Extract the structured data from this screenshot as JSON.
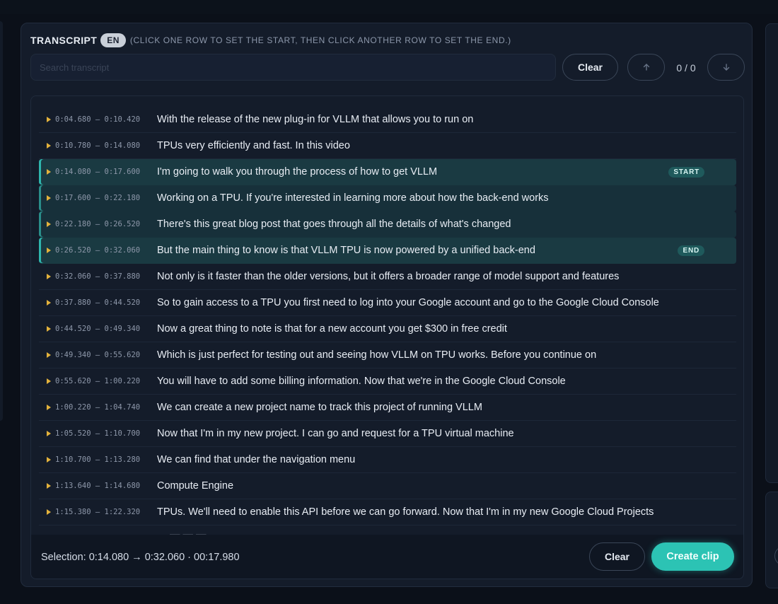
{
  "transcript": {
    "title": "TRANSCRIPT",
    "language": "EN",
    "hint": "(CLICK ONE ROW TO SET THE START, THEN CLICK ANOTHER ROW TO SET THE END.)",
    "search_placeholder": "Search transcript",
    "clear_label": "Clear",
    "match_counter": "0 / 0"
  },
  "rows": [
    {
      "time": "0:04.680 – 0:10.420",
      "text": "With the release of the new plug-in for VLLM that allows you to run on",
      "state": "none",
      "badge": ""
    },
    {
      "time": "0:10.780 – 0:14.080",
      "text": "TPUs very efficiently and fast. In this video",
      "state": "none",
      "badge": ""
    },
    {
      "time": "0:14.080 – 0:17.600",
      "text": "I'm going to walk you through the process of how to get VLLM",
      "state": "start",
      "badge": "START"
    },
    {
      "time": "0:17.600 – 0:22.180",
      "text": "Working on a TPU. If you're interested in learning more about how the back-end works",
      "state": "mid",
      "badge": ""
    },
    {
      "time": "0:22.180 – 0:26.520",
      "text": "There's this great blog post that goes through all the details of what's changed",
      "state": "mid",
      "badge": ""
    },
    {
      "time": "0:26.520 – 0:32.060",
      "text": "But the main thing to know is that VLLM TPU is now powered by a unified back-end",
      "state": "end",
      "badge": "END"
    },
    {
      "time": "0:32.060 – 0:37.880",
      "text": "Not only is it faster than the older versions, but it offers a broader range of model support and features",
      "state": "none",
      "badge": ""
    },
    {
      "time": "0:37.880 – 0:44.520",
      "text": "So to gain access to a TPU you first need to log into your Google account and go to the Google Cloud Console",
      "state": "none",
      "badge": ""
    },
    {
      "time": "0:44.520 – 0:49.340",
      "text": "Now a great thing to note is that for a new account you get $300 in free credit",
      "state": "none",
      "badge": ""
    },
    {
      "time": "0:49.340 – 0:55.620",
      "text": "Which is just perfect for testing out and seeing how VLLM on TPU works. Before you continue on",
      "state": "none",
      "badge": ""
    },
    {
      "time": "0:55.620 – 1:00.220",
      "text": "You will have to add some billing information. Now that we're in the Google Cloud Console",
      "state": "none",
      "badge": ""
    },
    {
      "time": "1:00.220 – 1:04.740",
      "text": "We can create a new project name to track this project of running VLLM",
      "state": "none",
      "badge": ""
    },
    {
      "time": "1:05.520 – 1:10.700",
      "text": "Now that I'm in my new project. I can go and request for a TPU virtual machine",
      "state": "none",
      "badge": ""
    },
    {
      "time": "1:10.700 – 1:13.280",
      "text": "We can find that under the navigation menu",
      "state": "none",
      "badge": ""
    },
    {
      "time": "1:13.640 – 1:14.680",
      "text": "Compute Engine",
      "state": "none",
      "badge": ""
    },
    {
      "time": "1:15.380 – 1:22.320",
      "text": "TPUs. We'll need to enable this API before we can go forward. Now that I'm in my new Google Cloud Projects",
      "state": "none",
      "badge": ""
    }
  ],
  "footer": {
    "selection": "Selection: 0:14.080 → 0:32.060 · 00:17.980",
    "clear_label": "Clear",
    "create_label": "Create clip"
  },
  "colors": {
    "accent": "#2cc3b4",
    "play": "#e3b23c",
    "selected_row": "#1a3a42"
  }
}
